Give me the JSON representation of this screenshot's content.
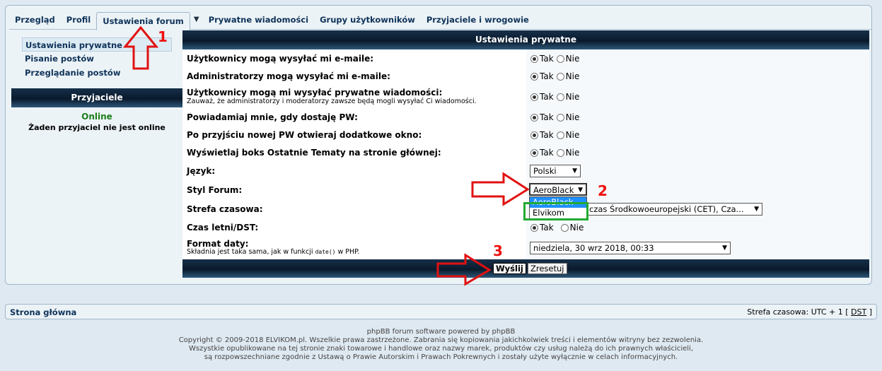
{
  "tabs": [
    {
      "label": "Przegląd"
    },
    {
      "label": "Profil"
    },
    {
      "label": "Ustawienia forum"
    },
    {
      "label": "Prywatne wiadomości"
    },
    {
      "label": "Grupy użytkowników"
    },
    {
      "label": "Przyjaciele i wrogowie"
    }
  ],
  "sidebar": {
    "items": [
      {
        "label": "Ustawienia prywatne"
      },
      {
        "label": "Pisanie postów"
      },
      {
        "label": "Przeglądanie postów"
      }
    ],
    "friends_header": "Przyjaciele",
    "online_label": "Online",
    "no_friends": "Żaden przyjaciel nie jest online"
  },
  "main": {
    "header": "Ustawienia prywatne",
    "yes": "Tak",
    "no": "Nie",
    "rows": [
      {
        "label": "Użytkownicy mogą wysyłać mi e-maile:"
      },
      {
        "label": "Administratorzy mogą wysyłać mi e-maile:"
      },
      {
        "label": "Użytkownicy mogą mi wysyłać prywatne wiadomości:",
        "note": "Zauważ, że administratorzy i moderatorzy zawsze będą mogli wysyłać Ci wiadomości."
      },
      {
        "label": "Powiadamiaj mnie, gdy dostaję PW:"
      },
      {
        "label": "Po przyjściu nowej PW otwieraj dodatkowe okno:"
      },
      {
        "label": "Wyświetlaj boks Ostatnie Tematy na stronie głównej:"
      }
    ],
    "language_label": "Język:",
    "language_value": "Polski",
    "style_label": "Styl Forum:",
    "style_value": "AeroBlack",
    "style_options": [
      "AeroBlack",
      "Elvikom"
    ],
    "timezone_label": "Strefa czasowa:",
    "timezone_value": "czas Środkowoeuropejski (CET), Cza...",
    "dst_label": "Czas letni/DST:",
    "date_label": "Format daty:",
    "date_note_pre": "Składnia jest taka sama, jak w funkcji",
    "date_note_code": "date()",
    "date_note_post": "w PHP.",
    "date_value": "niedziela, 30 wrz 2018, 00:33",
    "submit": "Wyślij",
    "reset": "Zresetuj"
  },
  "bottom": {
    "home": "Strona główna",
    "tz_prefix": "Strefa czasowa: UTC + 1 [",
    "tz_dst": "DST",
    "tz_suffix": "]"
  },
  "copyright": [
    "phpBB forum software powered by phpBB",
    "Copyright © 2009-2018 ELVIKOM.pl. Wszelkie prawa zastrzeżone. Zabrania się kopiowania jakichkolwiek treści i elementów witryny bez zezwolenia.",
    "Wszystkie opublikowane na tej stronie znaki towarowe i handlowe oraz nazwy marek, produktów czy usług należą do ich prawnych właścicieli,",
    "są rozpowszechniane zgodnie z Ustawą o Prawie Autorskim i Prawach Pokrewnych i zostały użyte wyłącznie w celach informacyjnych."
  ],
  "annotations": {
    "n1": "1",
    "n2": "2",
    "n3": "3"
  },
  "colors": {
    "accent_red": "#e11111",
    "accent_green": "#22aa33",
    "header_dark": "#0a1a2c",
    "link": "#0f3359"
  }
}
